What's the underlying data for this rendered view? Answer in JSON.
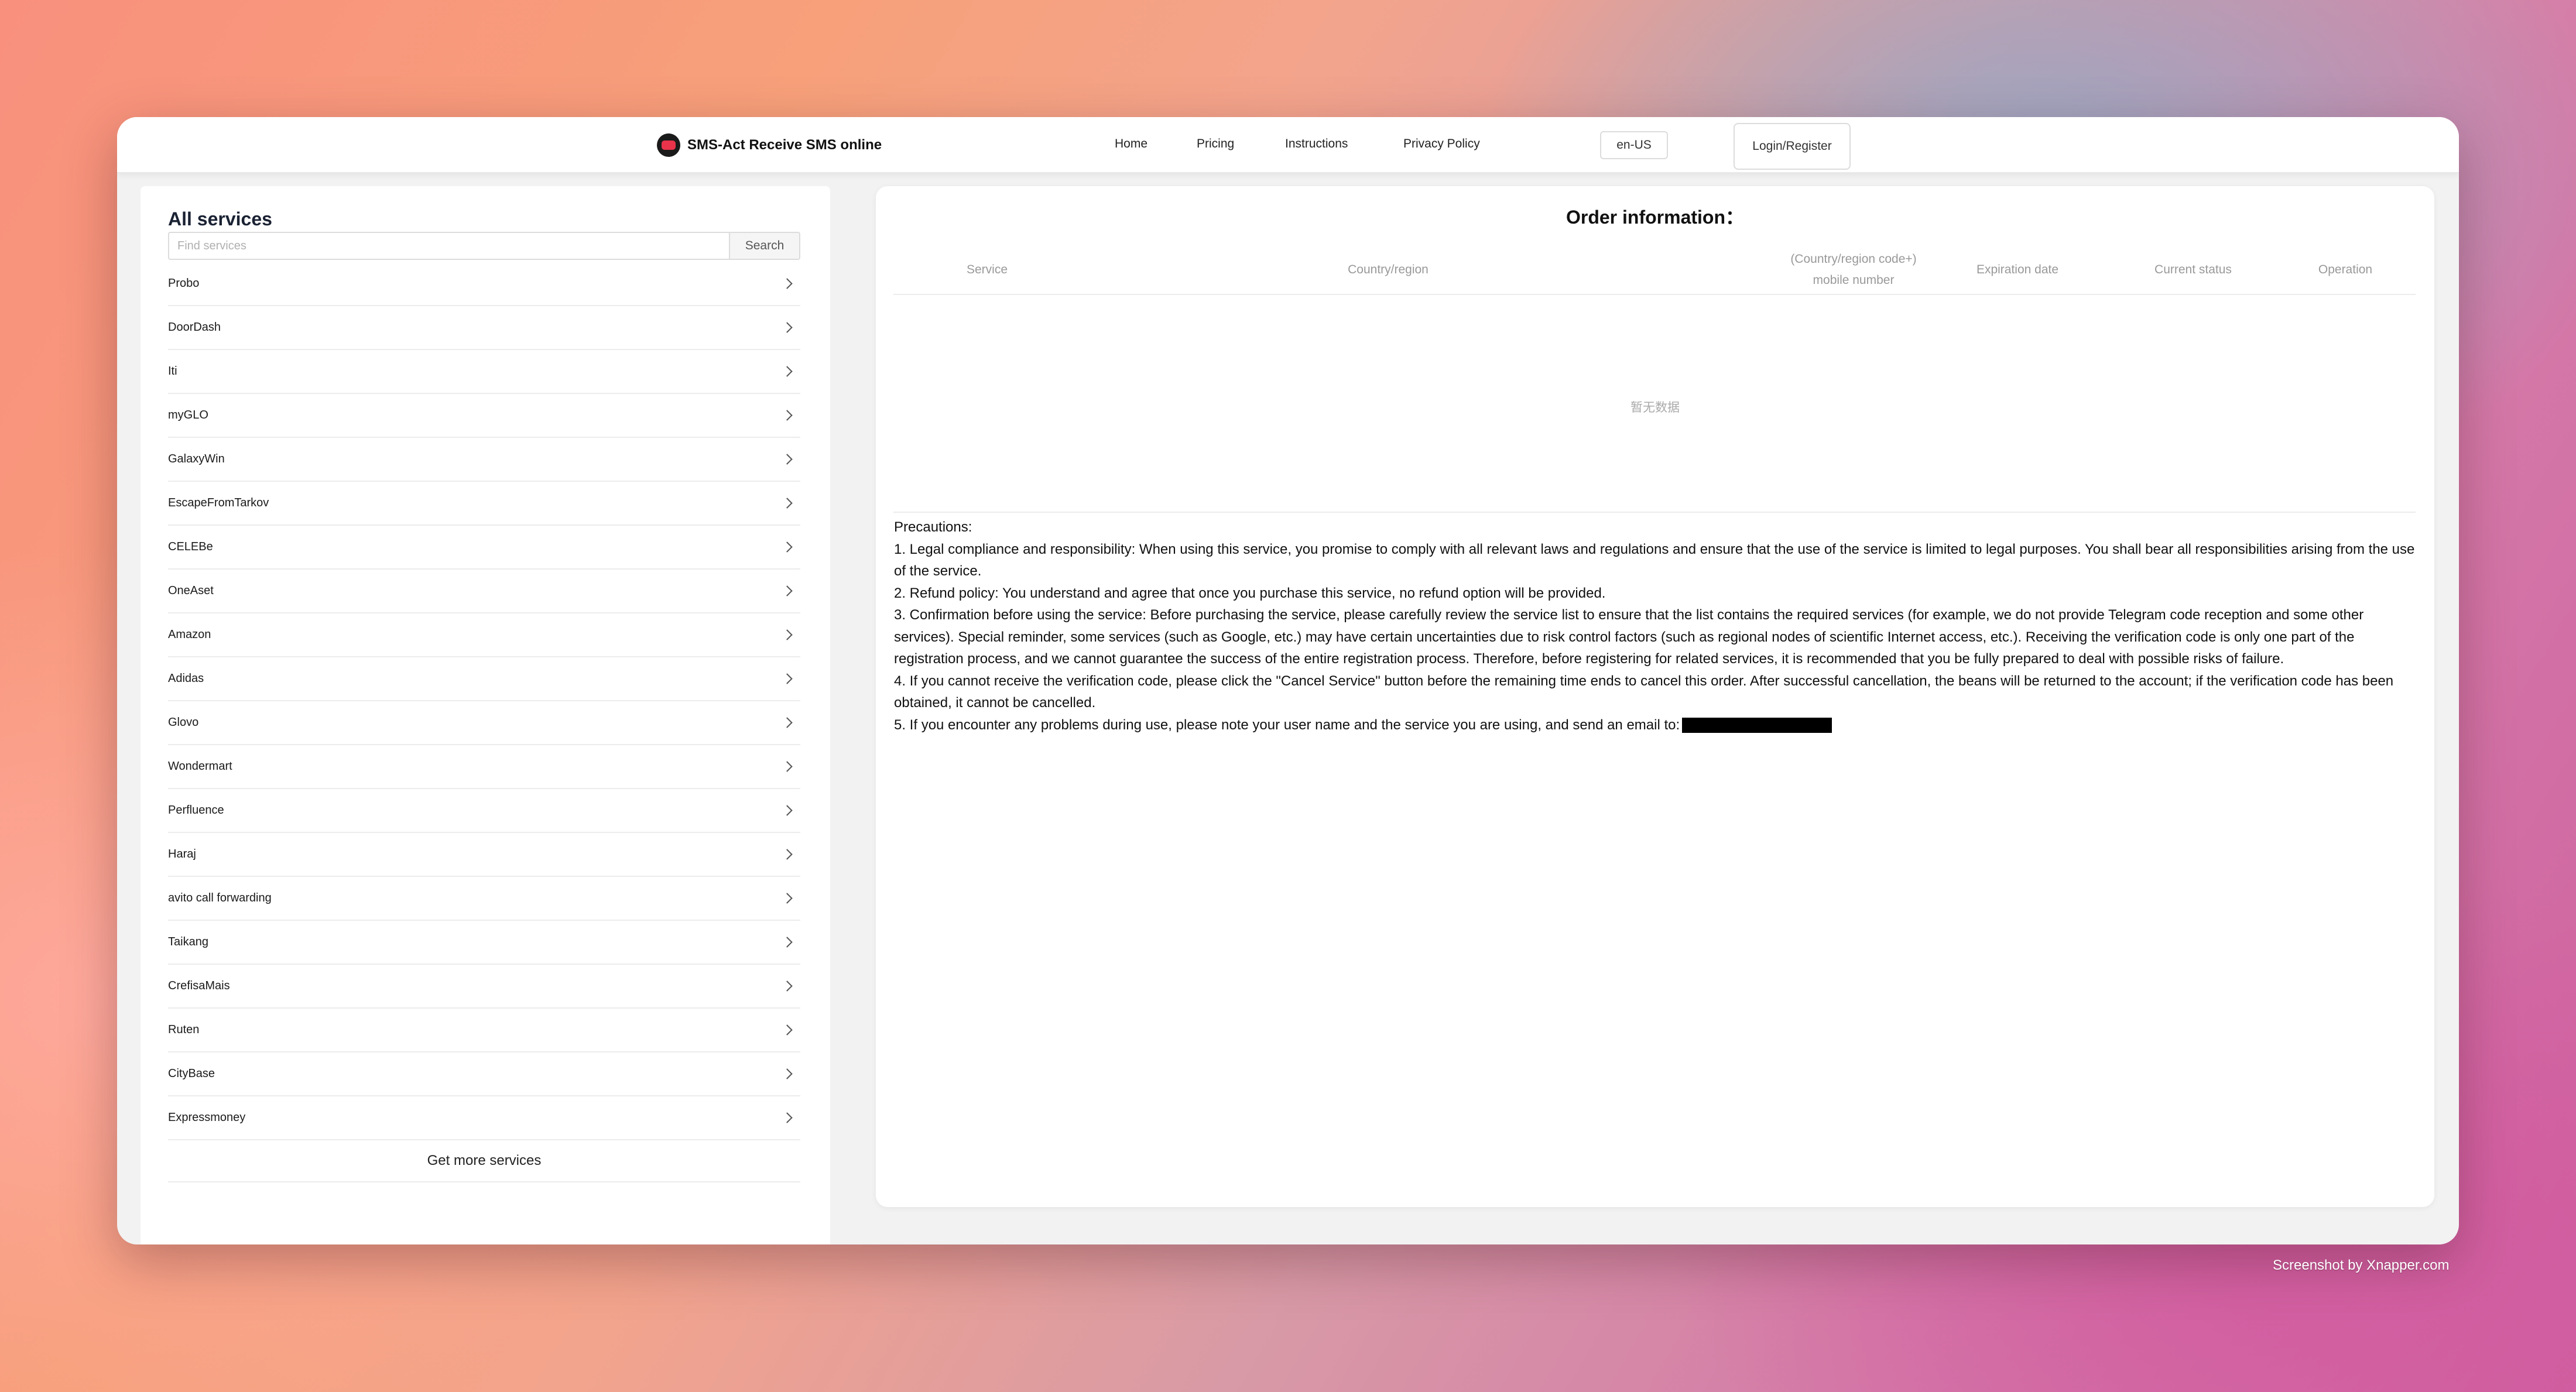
{
  "header": {
    "brand_name": "SMS-Act Receive SMS online",
    "nav": [
      "Home",
      "Pricing",
      "Instructions",
      "Privacy Policy"
    ],
    "language": "en-US",
    "login_label": "Login/Register",
    "brand_color": "#e8334a"
  },
  "sidebar": {
    "title": "All services",
    "search": {
      "placeholder": "Find services",
      "value": "",
      "button_label": "Search"
    },
    "services": [
      "Probo",
      "DoorDash",
      "Iti",
      "myGLO",
      "GalaxyWin",
      "EscapeFromTarkov",
      "CELEBe",
      "OneAset",
      "Amazon",
      "Adidas",
      "Glovo",
      "Wondermart",
      "Perfluence",
      "Haraj",
      "avito call forwarding",
      "Taikang",
      "CrefisaMais",
      "Ruten",
      "CityBase",
      "Expressmoney"
    ],
    "more_label": "Get more services"
  },
  "orders": {
    "title": "Order information：",
    "columns": [
      "Service",
      "Country/region",
      "(Country/region code+) mobile number",
      "Expiration date",
      "Current status",
      "Operation"
    ],
    "empty_text": "暂无数据"
  },
  "precautions": {
    "heading": "Precautions:",
    "items": [
      "1. Legal compliance and responsibility: When using this service, you promise to comply with all relevant laws and regulations and ensure that the use of the service is limited to legal purposes. You shall bear all responsibilities arising from the use of the service.",
      "2. Refund policy: You understand and agree that once you purchase this service, no refund option will be provided.",
      "3. Confirmation before using the service: Before purchasing the service, please carefully review the service list to ensure that the list contains the required services (for example, we do not provide Telegram code reception and some other services). Special reminder, some services (such as Google, etc.) may have certain uncertainties due to risk control factors (such as regional nodes of scientific Internet access, etc.). Receiving the verification code is only one part of the registration process, and we cannot guarantee the success of the entire registration process. Therefore, before registering for related services, it is recommended that you be fully prepared to deal with possible risks of failure.",
      "4. If you cannot receive the verification code, please click the \"Cancel Service\" button before the remaining time ends to cancel this order. After successful cancellation, the beans will be returned to the account; if the verification code has been obtained, it cannot be cancelled.",
      "5. If you encounter any problems during use, please note your user name and the service you are using, and send an email to:"
    ]
  },
  "watermark": "Screenshot by Xnapper.com"
}
